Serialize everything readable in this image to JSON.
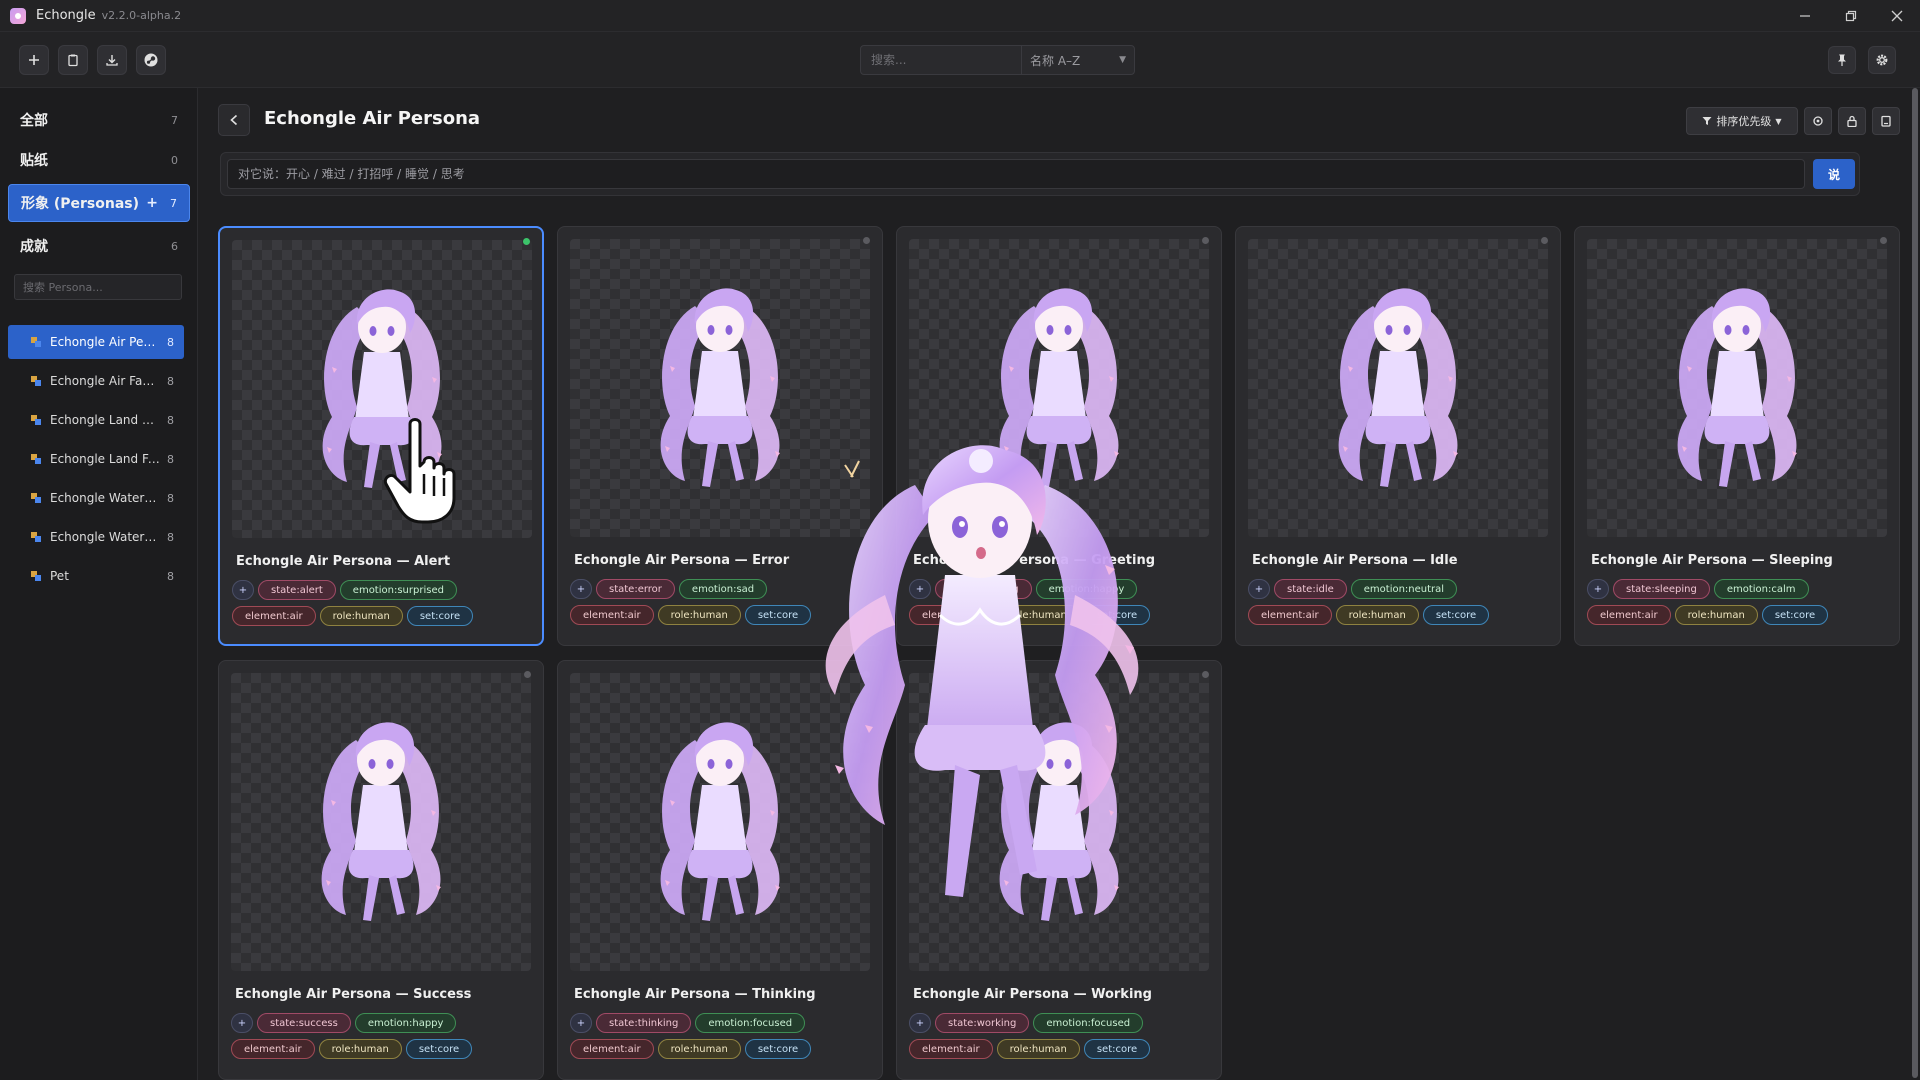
{
  "window": {
    "title": "Echongle",
    "version": "v2.2.0-alpha.2"
  },
  "toolbar": {
    "search_placeholder": "搜索...",
    "sort_label": "名称 A–Z"
  },
  "sidebar": {
    "categories": [
      {
        "label": "全部",
        "count": "7"
      },
      {
        "label": "贴纸",
        "count": "0"
      },
      {
        "label": "形象 (Personas)",
        "count": "7",
        "plus": "+"
      },
      {
        "label": "成就",
        "count": "6"
      }
    ],
    "search_placeholder": "搜索 Persona...",
    "personas": [
      {
        "label": "Echongle Air Pers...",
        "count": "8"
      },
      {
        "label": "Echongle Air Fami...",
        "count": "8"
      },
      {
        "label": "Echongle Land Pe...",
        "count": "8"
      },
      {
        "label": "Echongle Land Fa...",
        "count": "8"
      },
      {
        "label": "Echongle Water P...",
        "count": "8"
      },
      {
        "label": "Echongle Water F...",
        "count": "8"
      },
      {
        "label": "Pet",
        "count": "8"
      }
    ]
  },
  "main": {
    "title": "Echongle Air Persona",
    "sort_priority_label": "排序优先级",
    "say_placeholder": "对它说：开心 / 难过 / 打招呼 / 睡觉 / 思考",
    "say_button": "说"
  },
  "cards": [
    {
      "title": "Echongle Air Persona — Alert",
      "state": "state:alert",
      "emotion": "emotion:surprised",
      "element": "element:air",
      "role": "role:human",
      "set": "set:core"
    },
    {
      "title": "Echongle Air Persona — Error",
      "state": "state:error",
      "emotion": "emotion:sad",
      "element": "element:air",
      "role": "role:human",
      "set": "set:core"
    },
    {
      "title": "Echongle Air Persona — Greeting",
      "state": "state:greeting",
      "emotion": "emotion:happy",
      "element": "element:air",
      "role": "role:human",
      "set": "set:core"
    },
    {
      "title": "Echongle Air Persona — Idle",
      "state": "state:idle",
      "emotion": "emotion:neutral",
      "element": "element:air",
      "role": "role:human",
      "set": "set:core"
    },
    {
      "title": "Echongle Air Persona — Sleeping",
      "state": "state:sleeping",
      "emotion": "emotion:calm",
      "element": "element:air",
      "role": "role:human",
      "set": "set:core"
    },
    {
      "title": "Echongle Air Persona — Success",
      "state": "state:success",
      "emotion": "emotion:happy",
      "element": "element:air",
      "role": "role:human",
      "set": "set:core"
    },
    {
      "title": "Echongle Air Persona — Thinking",
      "state": "state:thinking",
      "emotion": "emotion:focused",
      "element": "element:air",
      "role": "role:human",
      "set": "set:core"
    },
    {
      "title": "Echongle Air Persona — Working",
      "state": "state:working",
      "emotion": "emotion:focused",
      "element": "element:air",
      "role": "role:human",
      "set": "set:core"
    }
  ],
  "tag_add_label": "+",
  "icons": {
    "add": "plus-icon",
    "clipboard": "clipboard-icon",
    "import": "download-icon",
    "steam": "steam-icon",
    "pin": "pin-icon",
    "settings": "gear-icon",
    "back": "chevron-left-icon",
    "filter": "filter-icon",
    "target": "target-icon",
    "lock": "lock-icon",
    "save": "save-icon"
  },
  "colors": {
    "accent": "#2c62c9",
    "active_dot": "#3cc36a",
    "selected_border": "#4b8cff"
  }
}
